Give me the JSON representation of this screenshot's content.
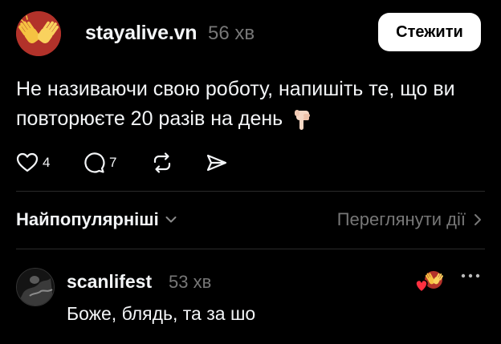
{
  "post": {
    "username": "stayalive.vn",
    "time": "56 хв",
    "follow_label": "Стежити",
    "text": "Не називаючи свою роботу, напишіть те, що ви повторюєте 20 разів на день",
    "avatar_icon": "clapping-hands-icon",
    "emoji_icon": "pointing-down-hand-emoji",
    "actions": {
      "likes": "4",
      "comments": "7"
    }
  },
  "sort_bar": {
    "sort_label": "Найпопулярніші",
    "activity_label": "Переглянути дії"
  },
  "comments": [
    {
      "username": "scanlifest",
      "time": "53 хв",
      "text": "Боже, блядь, та за шо"
    }
  ],
  "colors": {
    "background": "#000000",
    "text_primary": "#f3f5f7",
    "text_secondary": "#777777",
    "avatar_red": "#b2322a",
    "like_heart": "#ff3040",
    "follow_button": "#ffffff"
  }
}
